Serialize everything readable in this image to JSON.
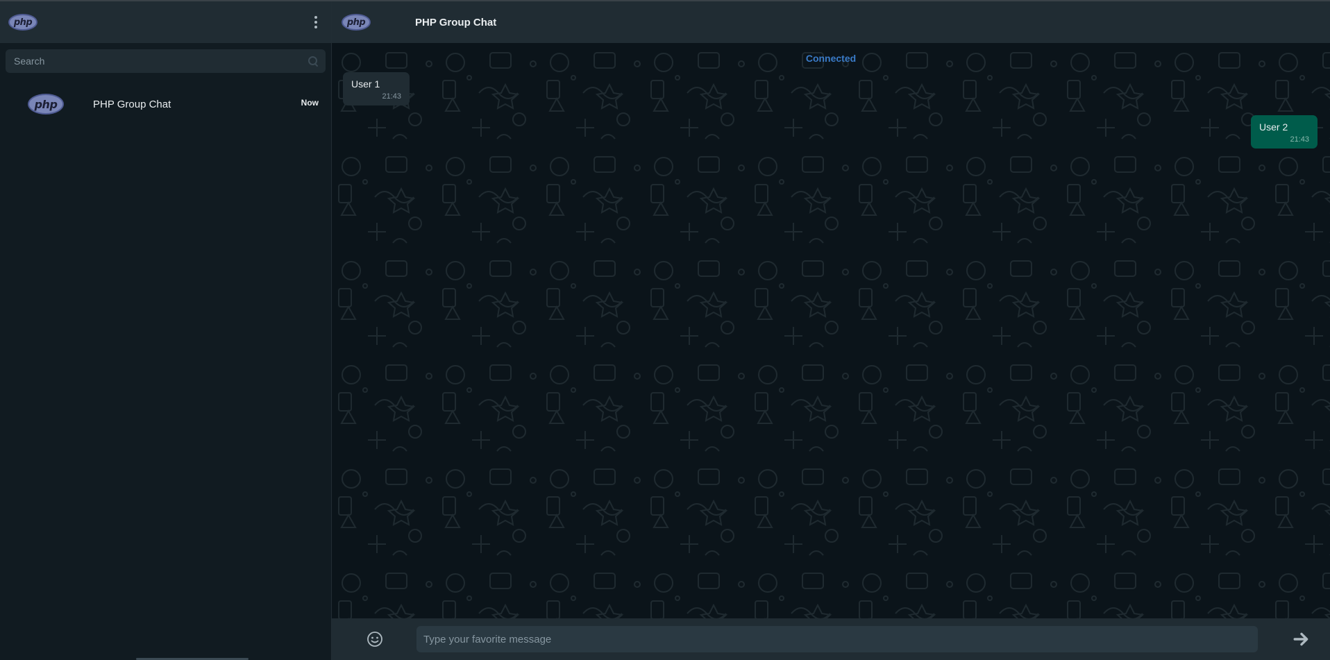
{
  "sidebar": {
    "logo_text": "php",
    "search": {
      "placeholder": "Search",
      "value": ""
    },
    "chats": [
      {
        "logo_text": "php",
        "name": "PHP Group Chat",
        "time": "Now"
      }
    ]
  },
  "chat": {
    "logo_text": "php",
    "title": "PHP Group Chat",
    "status": "Connected",
    "messages": [
      {
        "text": "User 1",
        "time": "21:43",
        "direction": "incoming"
      },
      {
        "text": "User 2",
        "time": "21:43",
        "direction": "outgoing"
      }
    ],
    "composer": {
      "placeholder": "Type your favorite message",
      "value": ""
    }
  },
  "icons": {
    "menu": "kebab-menu-icon",
    "search": "search-icon",
    "emoji": "smiley-icon",
    "send": "arrow-right-icon"
  },
  "colors": {
    "sidebar_bg": "#111b21",
    "header_bg": "#202c33",
    "chat_bg": "#0b141a",
    "incoming_bubble": "#202c33",
    "outgoing_bubble": "#005c4b",
    "status_text": "#3a7bc8"
  }
}
